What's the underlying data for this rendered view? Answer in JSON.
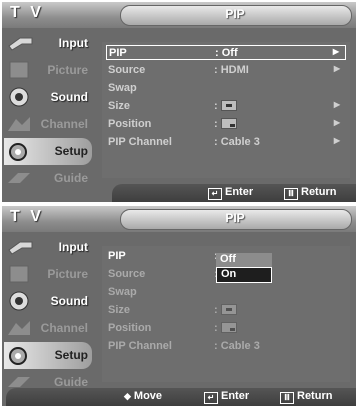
{
  "app": {
    "title": "T V"
  },
  "colors": {
    "panel": "#6a6a6a",
    "highlight": "#ffffff",
    "dimmed": "#9a9a9a"
  },
  "sidebar": {
    "items": [
      {
        "label": "Input",
        "icon": "input-icon",
        "state": "enabled"
      },
      {
        "label": "Picture",
        "icon": "picture-icon",
        "state": "dimmed"
      },
      {
        "label": "Sound",
        "icon": "sound-icon",
        "state": "enabled"
      },
      {
        "label": "Channel",
        "icon": "channel-icon",
        "state": "dimmed"
      },
      {
        "label": "Setup",
        "icon": "setup-icon",
        "state": "active"
      },
      {
        "label": "Guide",
        "icon": "guide-icon",
        "state": "dimmed"
      }
    ]
  },
  "screen1": {
    "title": "PIP",
    "rows": [
      {
        "label": "PIP",
        "value": ": Off",
        "arrow": "▶",
        "selected": true
      },
      {
        "label": "Source",
        "value": ": HDMI",
        "arrow": "▶"
      },
      {
        "label": "Swap",
        "value": "",
        "arrow": ""
      },
      {
        "label": "Size",
        "value": ":",
        "arrow": "▶"
      },
      {
        "label": "Position",
        "value": ":",
        "arrow": "▶"
      },
      {
        "label": "PIP Channel",
        "value": ": Cable 3",
        "arrow": "▶"
      }
    ],
    "footer": {
      "enter": "Enter",
      "return": "Return"
    }
  },
  "screen2": {
    "title": "PIP",
    "rows": [
      {
        "label": "PIP",
        "value": ":"
      },
      {
        "label": "Source",
        "value": ":"
      },
      {
        "label": "Swap",
        "value": ""
      },
      {
        "label": "Size",
        "value": ":"
      },
      {
        "label": "Position",
        "value": ":"
      },
      {
        "label": "PIP Channel",
        "value": ": Cable 3"
      }
    ],
    "dropdown": {
      "options": [
        "Off",
        "On"
      ],
      "selected": "On"
    },
    "footer": {
      "move": "Move",
      "enter": "Enter",
      "return": "Return"
    }
  }
}
